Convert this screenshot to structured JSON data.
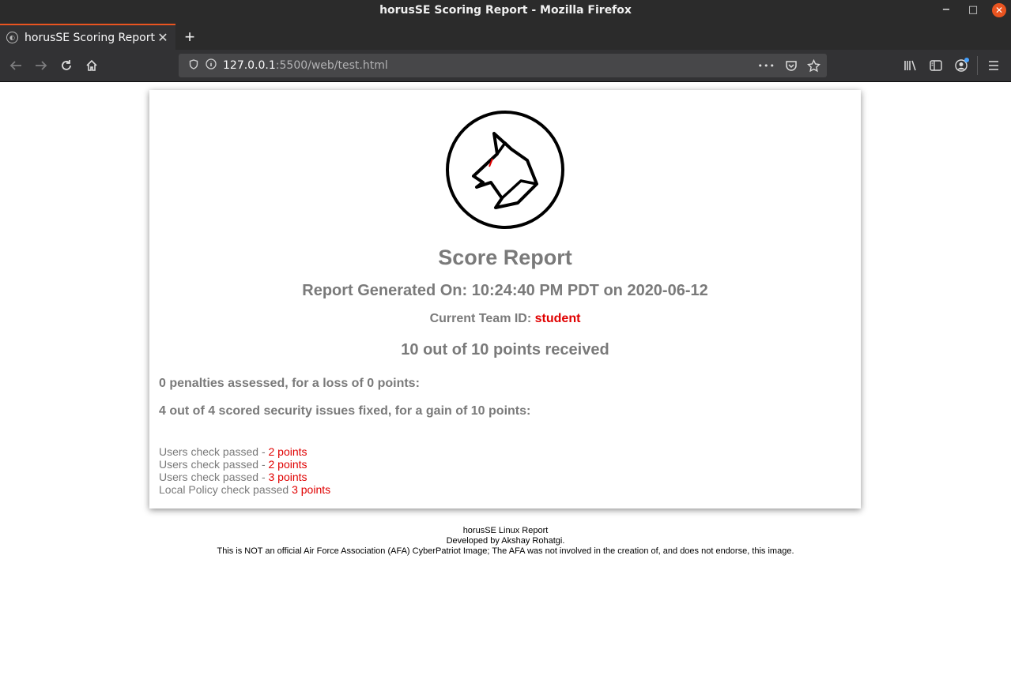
{
  "window": {
    "title": "horusSE Scoring Report - Mozilla Firefox",
    "controls": {
      "minimize": "−",
      "maximize": "□",
      "close": "✕"
    }
  },
  "tab": {
    "label": "horusSE Scoring Report",
    "close": "✕",
    "new_tab": "+"
  },
  "urlbar": {
    "host": "127.0.0.1",
    "path": ":5500/web/test.html",
    "more": "•••"
  },
  "report": {
    "title": "Score Report",
    "generated": "Report Generated On: 10:24:40 PM PDT on 2020-06-12",
    "team_label": "Current Team ID:",
    "team_id": "student",
    "points_summary": "10 out of 10 points received",
    "penalties": "0 penalties assessed, for a loss of 0 points:",
    "issues": "4 out of 4 scored security issues fixed, for a gain of 10 points:",
    "checks": [
      {
        "label": "Users check passed - ",
        "points": "2 points"
      },
      {
        "label": "Users check passed - ",
        "points": "2 points"
      },
      {
        "label": "Users check passed - ",
        "points": "3 points"
      },
      {
        "label": "Local Policy check passed ",
        "points": "3 points"
      }
    ]
  },
  "footer": {
    "line1": "horusSE Linux Report",
    "line2": "Developed by Akshay Rohatgi.",
    "line3": "This is NOT an official Air Force Association (AFA) CyberPatriot Image; The AFA was not involved in the creation of, and does not endorse, this image."
  },
  "colors": {
    "accent": "#e95420",
    "text_gray": "#7a7a7a",
    "points_red": "#e00000"
  }
}
